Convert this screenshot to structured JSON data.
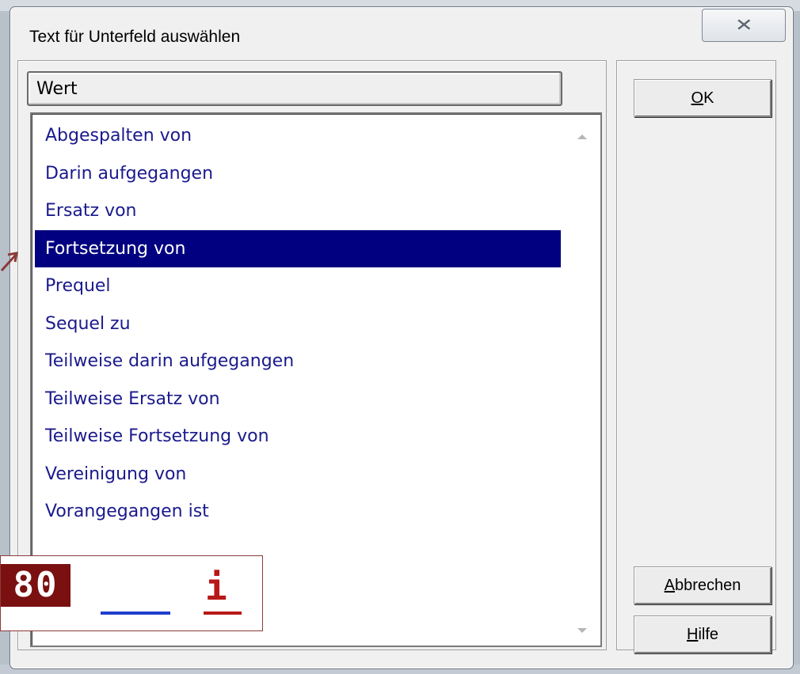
{
  "dialog": {
    "title": "Text für Unterfeld auswählen",
    "close_glyph": "☒"
  },
  "list": {
    "column_header": "Wert",
    "items": [
      "Abgespalten von",
      "Darin aufgegangen",
      "Ersatz von",
      "Fortsetzung von",
      "Prequel",
      "Sequel zu",
      "Teilweise darin aufgegangen",
      "Teilweise Ersatz von",
      "Teilweise Fortsetzung von",
      "Vereinigung von",
      "Vorangegangen ist"
    ],
    "selected_index": 3
  },
  "buttons": {
    "ok": {
      "mnemonic": "O",
      "rest": "K"
    },
    "cancel": {
      "mnemonic": "A",
      "rest": "bbrechen"
    },
    "help": {
      "mnemonic": "H",
      "rest": "ilfe"
    }
  },
  "overlay": {
    "number": "80",
    "info_letter": "i"
  },
  "colors": {
    "selection_bg": "#000080",
    "item_text": "#1a1a8c",
    "badge_bg": "#7a1010",
    "info_red": "#b81818",
    "line_blue": "#1f3fd0"
  }
}
